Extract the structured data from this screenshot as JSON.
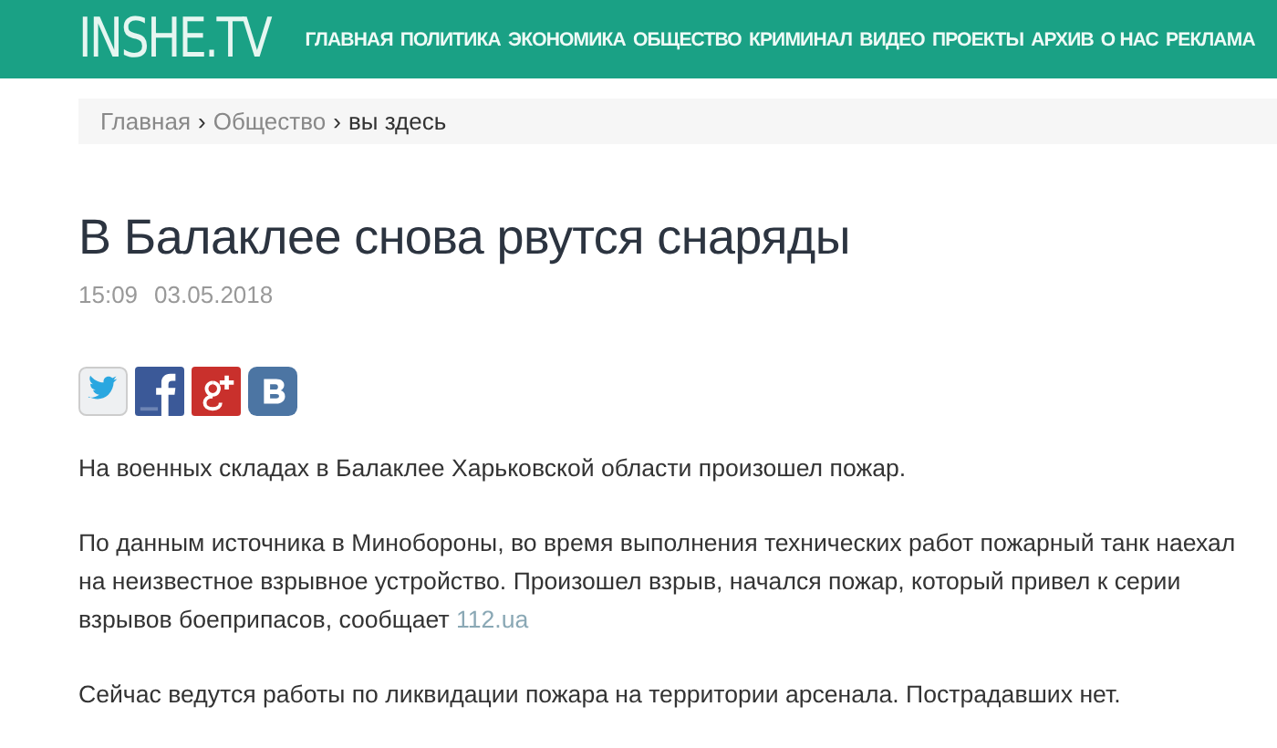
{
  "header": {
    "logo": "INSHE.TV",
    "nav": [
      "ГЛАВНАЯ",
      "ПОЛИТИКА",
      "ЭКОНОМИКА",
      "ОБЩЕСТВО",
      "КРИМИНАЛ",
      "ВИДЕО",
      "ПРОЕКТЫ",
      "АРХИВ",
      "О НАС",
      "РЕКЛАМА"
    ]
  },
  "breadcrumb": {
    "links": [
      "Главная",
      "Общество"
    ],
    "separator": "›",
    "current": "вы здесь"
  },
  "article": {
    "title": "В Балаклее снова рвутся снаряды",
    "time": "15:09",
    "date": "03.05.2018",
    "share": [
      {
        "kind": "twitter"
      },
      {
        "kind": "facebook"
      },
      {
        "kind": "googleplus"
      },
      {
        "kind": "vk"
      }
    ],
    "paragraphs": [
      {
        "text": "На военных складах в Балаклее Харьковской области произошел пожар."
      },
      {
        "text": "По данным источника в Минобороны, во время выполнения технических работ пожарный танк наехал на неизвестное взрывное устройство. Произошел взрыв, начался пожар, который привел к серии взрывов боеприпасов, сообщает ",
        "link": "112.ua"
      },
      {
        "text": "Сейчас ведутся работы по ликвидации пожара на территории арсенала. Пострадавших нет."
      }
    ]
  }
}
